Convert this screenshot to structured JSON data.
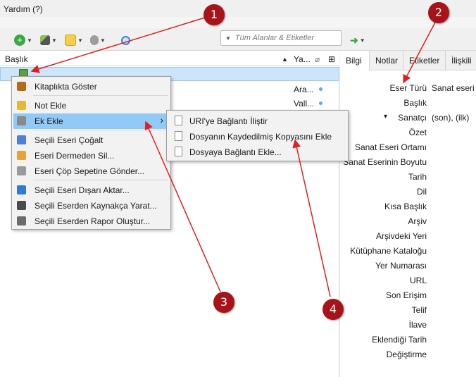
{
  "menubar": {
    "help": "Yardım (?)"
  },
  "toolbar": {
    "search_placeholder": "Tüm Alanlar & Etiketler"
  },
  "items_pane": {
    "columns": [
      "Başlık",
      "Ya...",
      "📎",
      "⊞"
    ],
    "rows": [
      {
        "title": "",
        "author": "",
        "selected": true
      },
      {
        "title": "",
        "author": "Ara...",
        "selected": false
      },
      {
        "title": "",
        "author": "Vall...",
        "selected": false
      }
    ]
  },
  "context_menu": {
    "items": [
      {
        "label": "Kitaplıkta Göster",
        "icon": "folder-icon",
        "color": "#b86a1c"
      },
      {
        "label": "Not Ekle",
        "icon": "note-icon",
        "color": "#e2b93b"
      },
      {
        "label": "Ek Ekle",
        "icon": "paperclip-icon",
        "color": "#8a8a8a",
        "highlight": true,
        "submenu": true
      },
      {
        "label": "Seçili Eseri Çoğalt",
        "icon": "duplicate-icon",
        "color": "#4f7fd6"
      },
      {
        "label": "Eseri Dermeden Sil...",
        "icon": "folder-remove-icon",
        "color": "#e7a23a"
      },
      {
        "label": "Eseri Çöp Sepetine Gönder...",
        "icon": "trash-icon",
        "color": "#9a9a9a"
      },
      {
        "label": "Seçili Eseri Dışarı Aktar...",
        "icon": "export-icon",
        "color": "#2f7bd3"
      },
      {
        "label": "Seçili Eserden Kaynakça Yarat...",
        "icon": "bibliography-icon",
        "color": "#4a4a4a"
      },
      {
        "label": "Seçili Eserden Rapor Oluştur...",
        "icon": "report-icon",
        "color": "#6b6b6b"
      }
    ]
  },
  "submenu": {
    "items": [
      {
        "label": "URI'ye Bağlantı İliştir",
        "icon": "link-icon"
      },
      {
        "label": "Dosyanın Kaydedilmiş Kopyasını Ekle",
        "icon": "file-icon"
      },
      {
        "label": "Dosyaya Bağlantı Ekle...",
        "icon": "file-link-icon"
      }
    ]
  },
  "info_pane": {
    "tabs": [
      "Bilgi",
      "Notlar",
      "Etiketler",
      "İlişkili"
    ],
    "fields": [
      {
        "label": "Eser Türü",
        "value": "Sanat eseri"
      },
      {
        "label": "Başlık",
        "value": ""
      },
      {
        "label": "Sanatçı",
        "value": "(son), (ilk)",
        "toggle": "▾"
      },
      {
        "label": "Özet",
        "value": ""
      },
      {
        "label": "Sanat Eseri Ortamı",
        "value": ""
      },
      {
        "label": "Sanat Eserinin Boyutu",
        "value": ""
      },
      {
        "label": "Tarih",
        "value": ""
      },
      {
        "label": "Dil",
        "value": ""
      },
      {
        "label": "Kısa Başlık",
        "value": ""
      },
      {
        "label": "Arşiv",
        "value": ""
      },
      {
        "label": "Arşivdeki Yeri",
        "value": ""
      },
      {
        "label": "Kütüphane Kataloğu",
        "value": ""
      },
      {
        "label": "Yer Numarası",
        "value": ""
      },
      {
        "label": "URL",
        "value": ""
      },
      {
        "label": "Son Erişim",
        "value": ""
      },
      {
        "label": "Telif",
        "value": ""
      },
      {
        "label": "İlave",
        "value": ""
      },
      {
        "label": "Eklendiği Tarih",
        "value": ""
      },
      {
        "label": "Değiştirme",
        "value": ""
      }
    ]
  },
  "annotations": [
    "1",
    "2",
    "3",
    "4"
  ],
  "colors": {
    "annotation": "#a8131a",
    "arrow": "#e02020",
    "highlight": "#91c9f7",
    "selection": "#cde5fb"
  }
}
